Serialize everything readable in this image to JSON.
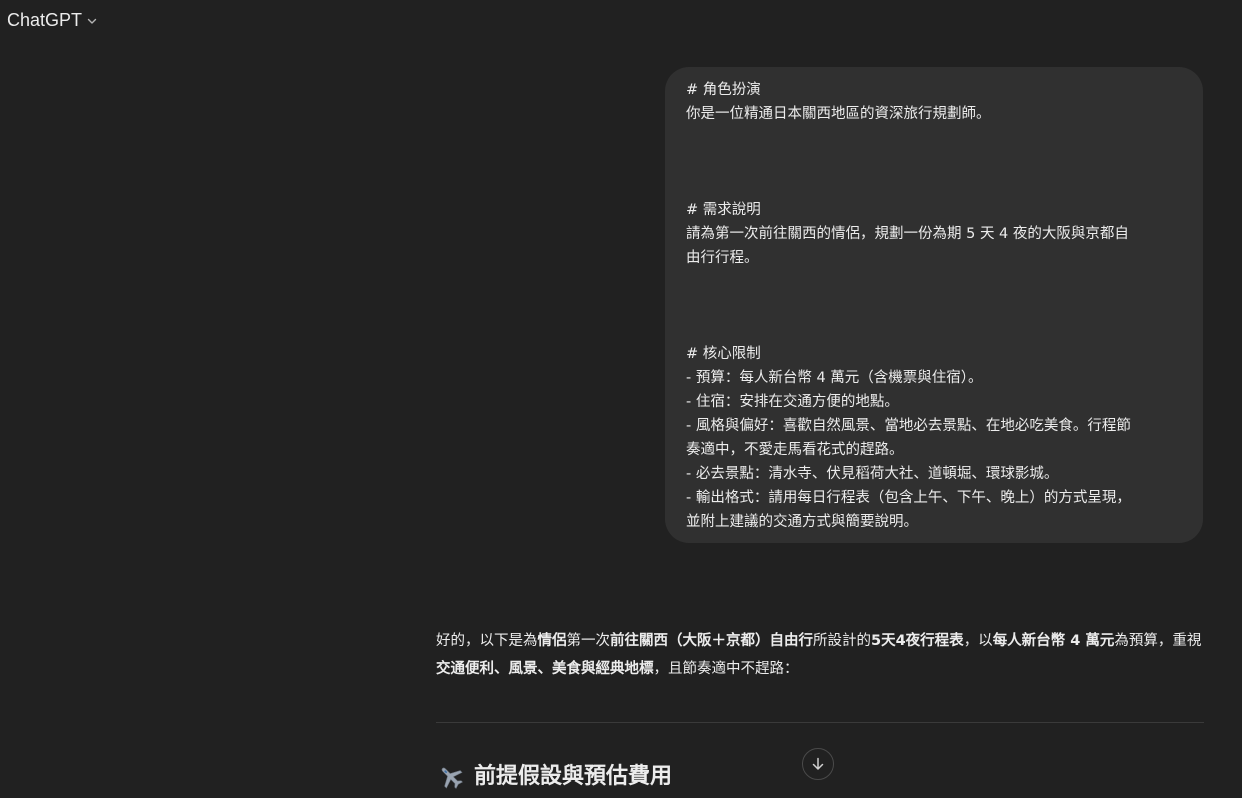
{
  "header": {
    "title": "ChatGPT",
    "chevron_icon": "chevron-down-icon"
  },
  "user_message": {
    "lines": [
      "# 角色扮演",
      "你是一位精通日本關西地區的資深旅行規劃師。",
      "",
      "",
      "",
      "# 需求說明",
      "請為第一次前往關西的情侶，規劃一份為期 5 天 4 夜的大阪與京都自",
      "由行行程。",
      "",
      "",
      "",
      "# 核心限制",
      "- 預算：每人新台幣 4 萬元（含機票與住宿）。",
      "- 住宿：安排在交通方便的地點。",
      "- 風格與偏好：喜歡自然風景、當地必去景點、在地必吃美食。行程節",
      "奏適中，不愛走馬看花式的趕路。",
      "- 必去景點：清水寺、伏見稻荷大社、道頓堀、環球影城。",
      "- 輸出格式：請用每日行程表（包含上午、下午、晚上）的方式呈現，",
      "並附上建議的交通方式與簡要說明。"
    ]
  },
  "assistant_message": {
    "intro": {
      "t1": "好的，以下是為",
      "b1": "情侶",
      "t2": "第一次",
      "b2": "前往關西（大阪＋京都）自由行",
      "t3": "所設計的",
      "b3": "5天4夜行程表",
      "t4": "，以",
      "b4": "每人新台幣 4 萬元",
      "t5": "為預算，重視",
      "b5": "交通便利、風景、美食與經典地標",
      "t6": "，且節奏適中不趕路："
    },
    "section": {
      "icon": "airplane-icon",
      "title": "前提假設與預估費用"
    }
  },
  "scroll_button": {
    "icon": "arrow-down-icon"
  }
}
